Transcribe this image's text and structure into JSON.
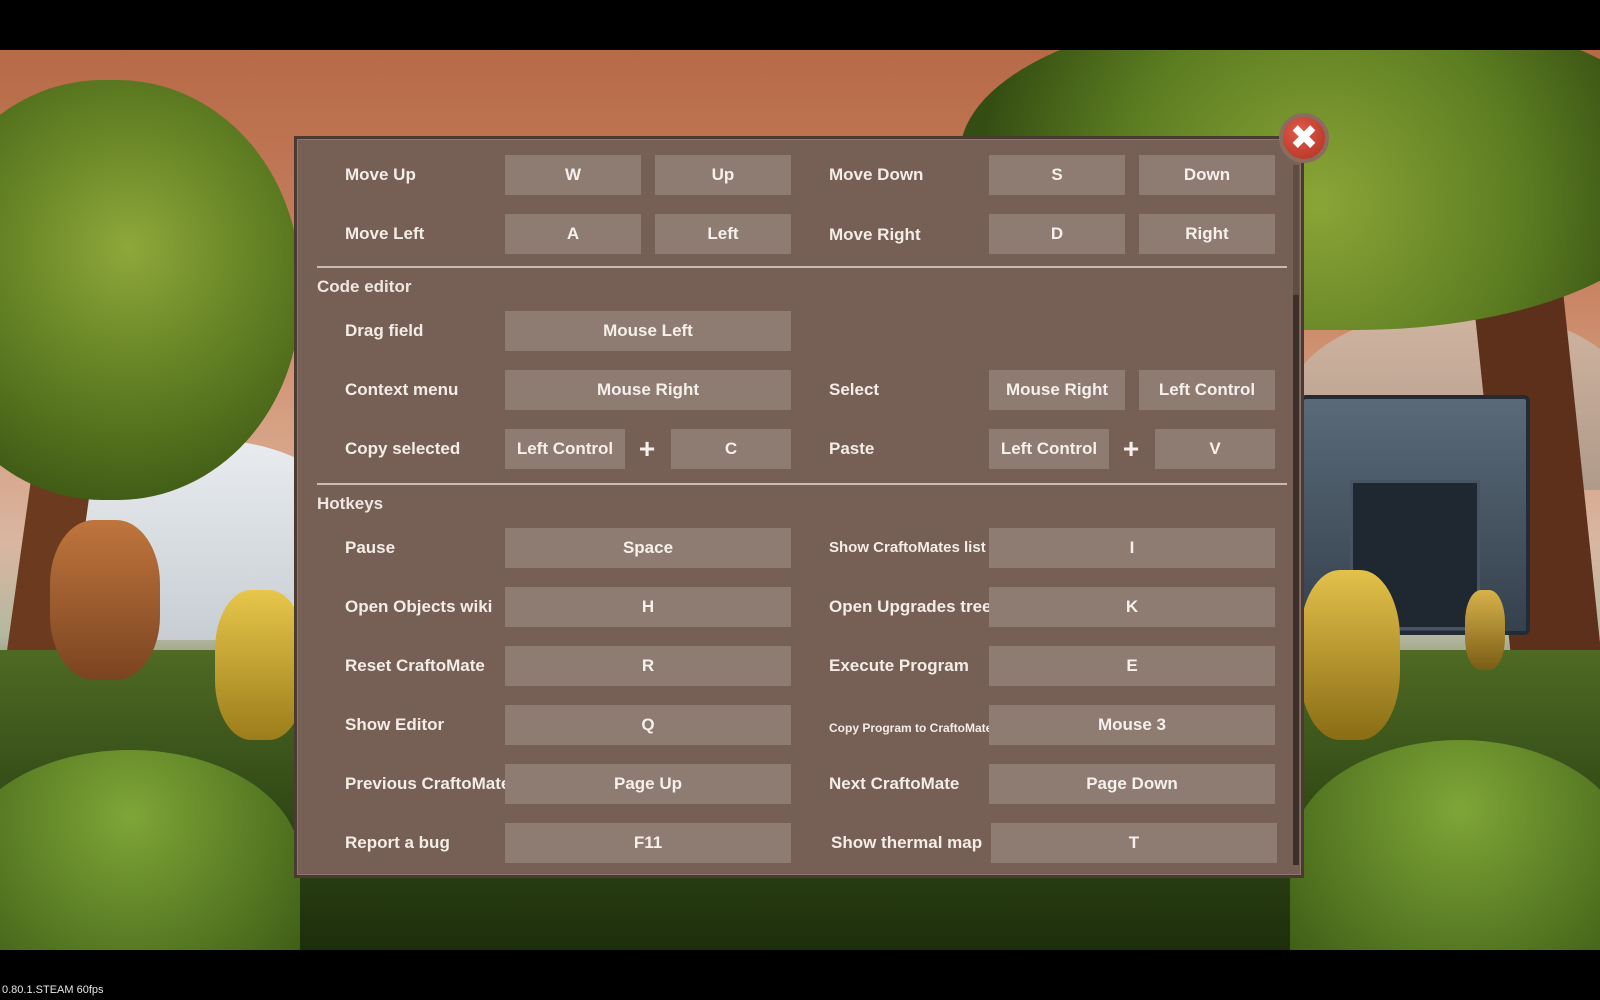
{
  "sections": {
    "code_editor": "Code editor",
    "hotkeys": "Hotkeys"
  },
  "rows": {
    "move_up": {
      "label": "Move Up",
      "key1": "W",
      "key2": "Up"
    },
    "move_down": {
      "label": "Move Down",
      "key1": "S",
      "key2": "Down"
    },
    "move_left": {
      "label": "Move Left",
      "key1": "A",
      "key2": "Left"
    },
    "move_right": {
      "label": "Move Right",
      "key1": "D",
      "key2": "Right"
    },
    "drag_field": {
      "label": "Drag field",
      "key": "Mouse Left"
    },
    "context_menu": {
      "label": "Context menu",
      "key": "Mouse Right"
    },
    "select": {
      "label": "Select",
      "key1": "Mouse Right",
      "key2": "Left Control"
    },
    "copy_selected": {
      "label": "Copy selected",
      "key1": "Left Control",
      "key2": "C"
    },
    "paste": {
      "label": "Paste",
      "key1": "Left Control",
      "key2": "V"
    },
    "pause": {
      "label": "Pause",
      "key": "Space"
    },
    "show_craftomates_list": {
      "label": "Show CraftoMates list",
      "key": "I"
    },
    "open_objects_wiki": {
      "label": "Open Objects wiki",
      "key": "H"
    },
    "open_upgrades_tree": {
      "label": "Open Upgrades tree",
      "key": "K"
    },
    "reset_craftomate": {
      "label": "Reset CraftoMate",
      "key": "R"
    },
    "execute_program": {
      "label": "Execute Program",
      "key": "E"
    },
    "show_editor": {
      "label": "Show Editor",
      "key": "Q"
    },
    "copy_program": {
      "label": "Copy Program to CraftoMate",
      "key": "Mouse 3"
    },
    "previous_craftomate": {
      "label": "Previous CraftoMate",
      "key": "Page Up"
    },
    "next_craftomate": {
      "label": "Next CraftoMate",
      "key": "Page Down"
    },
    "report_bug": {
      "label": "Report a bug",
      "key": "F11"
    },
    "show_thermal_map": {
      "label": "Show thermal map",
      "key": "T"
    }
  },
  "plus_symbol": "+",
  "close_symbol": "✖",
  "version": "0.80.1.STEAM 60fps",
  "colors": {
    "panel": "#765f55",
    "key_button": "#8e7b72",
    "close_button": "#c0392b"
  }
}
